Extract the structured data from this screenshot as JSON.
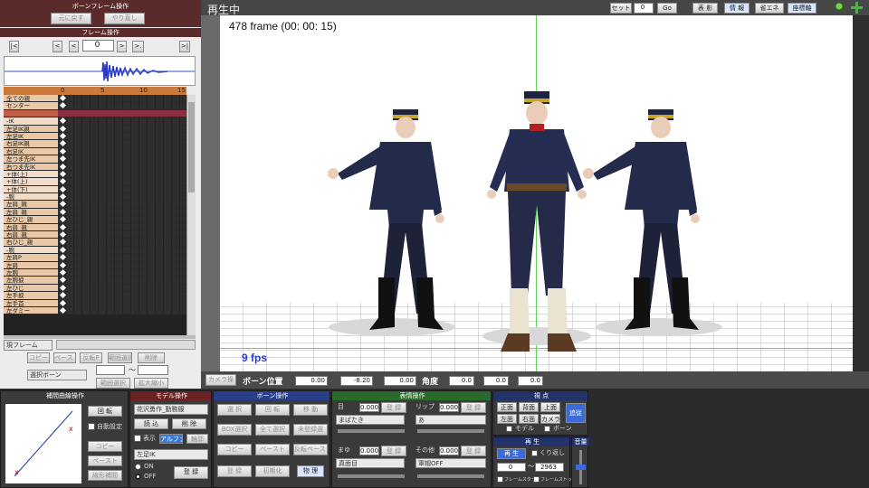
{
  "left": {
    "title": "ボーンフレーム操作",
    "undo": "元に戻す",
    "redo": "やり直し",
    "frame_op": "フレーム操作",
    "frame_value": "0",
    "ruler": [
      "0",
      "5",
      "10",
      "15"
    ],
    "bones": [
      {
        "label": "全ての親",
        "type": "normal"
      },
      {
        "label": "センター",
        "type": "normal"
      },
      {
        "label": "",
        "type": "sel"
      },
      {
        "label": "-IK",
        "type": "grp"
      },
      {
        "label": "左足IK親",
        "type": "normal"
      },
      {
        "label": "左足IK",
        "type": "normal"
      },
      {
        "label": "右足IK親",
        "type": "normal"
      },
      {
        "label": "右足IK",
        "type": "normal"
      },
      {
        "label": "左つま先IK",
        "type": "normal"
      },
      {
        "label": "右つま先IK",
        "type": "normal"
      },
      {
        "label": "+体(上)",
        "type": "grp"
      },
      {
        "label": "+体(上)",
        "type": "grp"
      },
      {
        "label": "+体(下)",
        "type": "grp"
      },
      {
        "label": "-腕",
        "type": "grp"
      },
      {
        "label": "左肩_親",
        "type": "normal"
      },
      {
        "label": "左肩_親",
        "type": "normal"
      },
      {
        "label": "左ひじ_親",
        "type": "normal"
      },
      {
        "label": "右肩_親",
        "type": "normal"
      },
      {
        "label": "右肩_親",
        "type": "normal"
      },
      {
        "label": "右ひじ_親",
        "type": "normal"
      },
      {
        "label": "-腕",
        "type": "grp"
      },
      {
        "label": "左肩P",
        "type": "normal"
      },
      {
        "label": "左肩",
        "type": "normal"
      },
      {
        "label": "左腕",
        "type": "normal"
      },
      {
        "label": "左腕捩",
        "type": "normal"
      },
      {
        "label": "左ひじ",
        "type": "normal"
      },
      {
        "label": "左手捩",
        "type": "normal"
      },
      {
        "label": "左手首",
        "type": "normal"
      },
      {
        "label": "左ダミー",
        "type": "normal"
      }
    ],
    "bottom_dd": "現フレーム",
    "copy": "コピー",
    "paste": "ペースト",
    "reverse": "反転P",
    "frame_select": "範囲選択",
    "delete": "削除",
    "select_bone": "選択ボーン",
    "tilde": "〜",
    "range_select": "範囲選択",
    "expand": "拡大縮小"
  },
  "viewport": {
    "status": "再生中",
    "frame_text": "478 frame (00: 00: 15)",
    "fps": "9 fps",
    "set_label": "セット",
    "set_value": "0",
    "go": "Go",
    "buttons": [
      "表 影",
      "情 報",
      "省エネ",
      "座標軸"
    ]
  },
  "coords": {
    "camera": "カメラ操",
    "pos_label": "ボーン位置",
    "pos": [
      "0.00",
      "-8.20",
      "0.00"
    ],
    "rot_label": "角度",
    "rot": [
      "0.0",
      "0.0",
      "0.0"
    ]
  },
  "interp": {
    "title": "補間曲線操作",
    "rotate": "回 転",
    "auto": "自動設定",
    "copy": "コピー",
    "paste": "ペースト",
    "linear": "線形補間"
  },
  "model": {
    "title": "モデル操作",
    "load": "読 込",
    "delete": "削 除",
    "model_dd": "花沢勇作_勤務服",
    "display": "表示",
    "alpha": "アルファ",
    "outline": "輪郭",
    "bone_dd": "左足IK",
    "on": "ON",
    "off": "OFF",
    "register": "登 録"
  },
  "bone": {
    "title": "ボーン操作",
    "select": "選 択",
    "rotate": "回 転",
    "move": "移 動",
    "box_select": "BOX選択",
    "select_all": "全て選択",
    "unregistered": "未登録選",
    "copy": "コピー",
    "paste": "ペースト",
    "reverse_paste": "反転ペースト",
    "register": "登 録",
    "init": "初期化",
    "physics": "物 理"
  },
  "face": {
    "title": "表情操作",
    "eye": "目",
    "lip": "リップ",
    "brow": "まゆ",
    "other": "その他",
    "eye_val": "0.000",
    "lip_val": "0.000",
    "brow_val": "0.000",
    "other_val": "0.000",
    "eye_dd": "まばたき",
    "lip_dd": "あ",
    "brow_dd": "真面目",
    "other_dd": "軍帽OFF",
    "register": "登 録"
  },
  "view": {
    "title": "視 点",
    "front": "正面",
    "back": "背面",
    "top": "上面",
    "left": "左面",
    "right": "右面",
    "camera": "カメラ",
    "track": "追従",
    "model": "モデル",
    "bone": "ボーン"
  },
  "play": {
    "title": "再 生",
    "play": "再 生",
    "repeat": "くり返し",
    "from": "0",
    "to": "2963",
    "tilde": "〜",
    "frame_start": "フレームスタート",
    "frame_stop": "フレームストップ"
  },
  "volume": {
    "title": "音量"
  }
}
